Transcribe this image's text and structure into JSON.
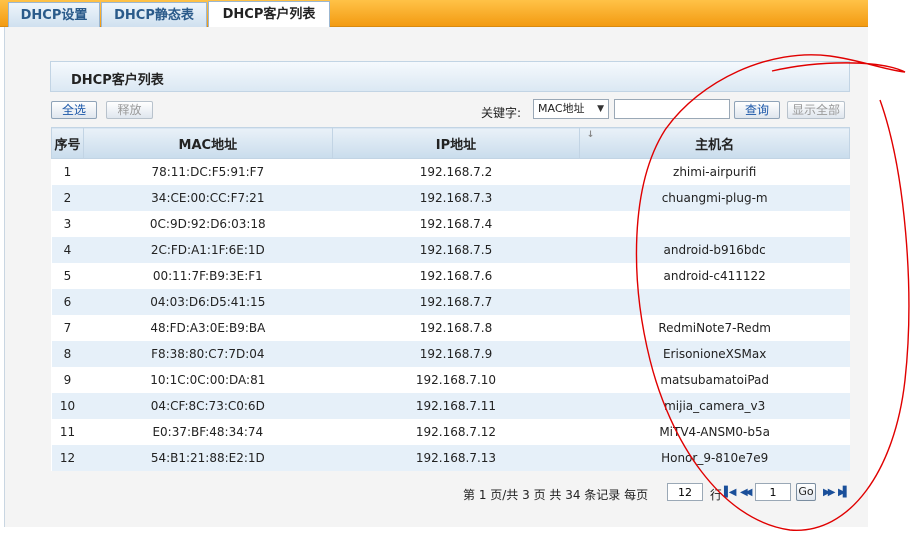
{
  "tabs": [
    {
      "label": "DHCP设置"
    },
    {
      "label": "DHCP静态表"
    },
    {
      "label": "DHCP客户列表"
    }
  ],
  "panel": {
    "title": "DHCP客户列表"
  },
  "toolbar": {
    "select_all": "全选",
    "release": "释放",
    "keyword_label": "关键字:",
    "keyword_select": "MAC地址",
    "keyword_value": "",
    "search": "查询",
    "show_all": "显示全部"
  },
  "table": {
    "columns": [
      "序号",
      "MAC地址",
      "IP地址",
      "主机名"
    ],
    "rows": [
      [
        "1",
        "78:11:DC:F5:91:F7",
        "192.168.7.2",
        "zhimi-airpurifi"
      ],
      [
        "2",
        "34:CE:00:CC:F7:21",
        "192.168.7.3",
        "chuangmi-plug-m"
      ],
      [
        "3",
        "0C:9D:92:D6:03:18",
        "192.168.7.4",
        ""
      ],
      [
        "4",
        "2C:FD:A1:1F:6E:1D",
        "192.168.7.5",
        "android-b916bdc"
      ],
      [
        "5",
        "00:11:7F:B9:3E:F1",
        "192.168.7.6",
        "android-c411122"
      ],
      [
        "6",
        "04:03:D6:D5:41:15",
        "192.168.7.7",
        ""
      ],
      [
        "7",
        "48:FD:A3:0E:B9:BA",
        "192.168.7.8",
        "RedmiNote7-Redm"
      ],
      [
        "8",
        "F8:38:80:C7:7D:04",
        "192.168.7.9",
        "ErisonioneXSMax"
      ],
      [
        "9",
        "10:1C:0C:00:DA:81",
        "192.168.7.10",
        "matsubamatoiPad"
      ],
      [
        "10",
        "04:CF:8C:73:C0:6D",
        "192.168.7.11",
        "mijia_camera_v3"
      ],
      [
        "11",
        "E0:37:BF:48:34:74",
        "192.168.7.12",
        "MiTV4-ANSM0-b5a"
      ],
      [
        "12",
        "54:B1:21:88:E2:1D",
        "192.168.7.13",
        "Honor_9-810e7e9"
      ]
    ]
  },
  "pager": {
    "text_before": "第 1 页/共 3 页 共 34 条记录 每页",
    "per_page": "12",
    "rows_label": "行",
    "page_input": "1",
    "go_label": "Go"
  },
  "annotation_color": "#e00000"
}
